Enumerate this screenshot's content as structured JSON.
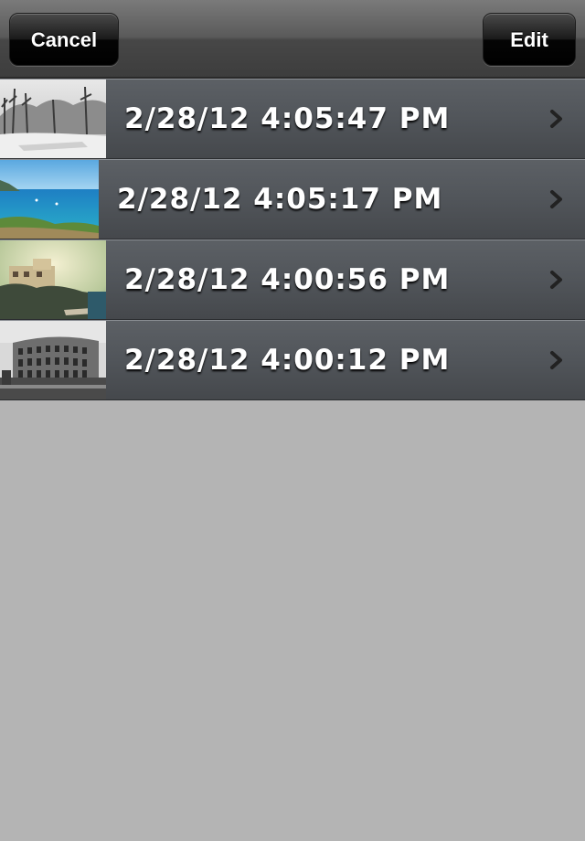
{
  "navbar": {
    "cancel_label": "Cancel",
    "edit_label": "Edit"
  },
  "photos": [
    {
      "label": "2/28/12 4:05:47 PM",
      "thumbnail_icon": "snowy-park-photo"
    },
    {
      "label": "2/28/12 4:05:17 PM",
      "thumbnail_icon": "sea-coast-photo"
    },
    {
      "label": "2/28/12 4:00:56 PM",
      "thumbnail_icon": "cliff-castle-photo"
    },
    {
      "label": "2/28/12 4:00:12 PM",
      "thumbnail_icon": "colosseum-photo"
    }
  ],
  "colors": {
    "background": "#b4b4b4",
    "row": "#51555a",
    "navbar": "#4a4a4a"
  }
}
